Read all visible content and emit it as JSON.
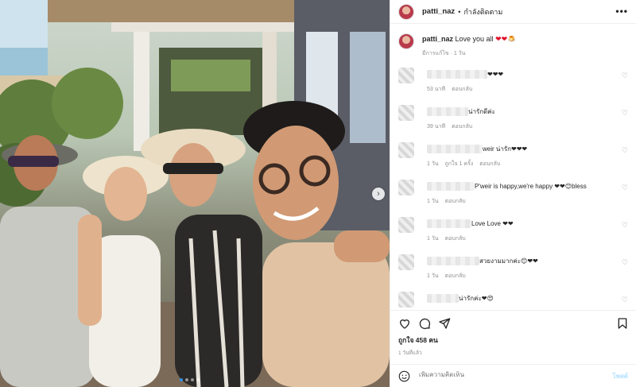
{
  "post": {
    "username": "patti_naz",
    "separator": "•",
    "follow_status": "กำลังติดตาม",
    "more": "•••"
  },
  "caption": {
    "username": "patti_naz",
    "text": "Love you all",
    "emoji": "❤❤🍮",
    "meta": "มีการแก้ไข · 1 วัน"
  },
  "comments": [
    {
      "text": "❤❤❤",
      "blur_width": 76,
      "time": "53 นาที",
      "likes": "",
      "reply": "ตอบกลับ"
    },
    {
      "text": "น่ารักดีค่ะ",
      "blur_width": 52,
      "time": "39 นาที",
      "likes": "",
      "reply": "ตอบกลับ"
    },
    {
      "text": "weir น่ารัก❤❤❤",
      "blur_width": 70,
      "time": "1 วัน",
      "likes": "ถูกใจ 1 ครั้ง",
      "reply": "ตอบกลับ"
    },
    {
      "text": "P'weir is happy,we're happy ❤❤😊bless",
      "blur_width": 60,
      "time": "1 วัน",
      "likes": "",
      "reply": "ตอบกลับ"
    },
    {
      "text": "Love Love ❤❤",
      "blur_width": 56,
      "time": "1 วัน",
      "likes": "",
      "reply": "ตอบกลับ"
    },
    {
      "text": "สวยงามมากค่ะ😊❤❤",
      "blur_width": 66,
      "time": "1 วัน",
      "likes": "",
      "reply": "ตอบกลับ"
    },
    {
      "text": "น่ารักค่ะ❤😍",
      "blur_width": 40,
      "time": "",
      "likes": "",
      "reply": ""
    }
  ],
  "stats": {
    "likes": "ถูกใจ 458 คน",
    "posted": "1 วันที่แล้ว"
  },
  "composer": {
    "placeholder": "เพิ่มความคิดเห็น",
    "post_label": "โพสต์"
  },
  "icons": {
    "like": "heart-icon",
    "comment": "comment-icon",
    "share": "paper-plane-icon",
    "save": "bookmark-icon",
    "emoji": "smile-icon",
    "carousel": "chevron-right-icon"
  },
  "colors": {
    "heart": "#e0102a",
    "muted": "#8e8e8e",
    "post_button": "#b2dffc",
    "carousel_active_dot": "#2f8ff0"
  },
  "carousel": {
    "count": 4,
    "active": 0
  }
}
